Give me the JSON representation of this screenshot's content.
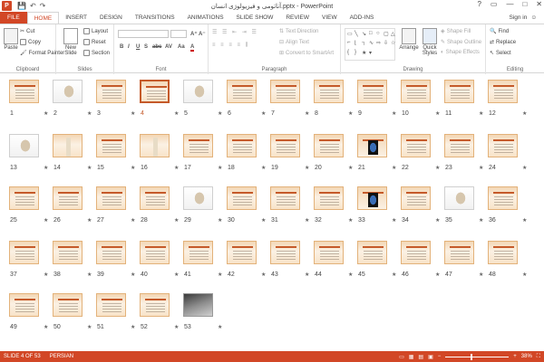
{
  "title": "آناتومی و فیزیولوژی انسان.pptx - PowerPoint",
  "qat": {
    "save_icon": "💾",
    "undo_icon": "↶",
    "redo_icon": "↷"
  },
  "window": {
    "help": "?",
    "restore": "▭",
    "minimize": "—",
    "maximize": "□",
    "close": "✕"
  },
  "tabs": [
    "FILE",
    "HOME",
    "INSERT",
    "DESIGN",
    "TRANSITIONS",
    "ANIMATIONS",
    "SLIDE SHOW",
    "REVIEW",
    "VIEW",
    "ADD-INS"
  ],
  "active_tab": "HOME",
  "signin": "Sign in",
  "ribbon": {
    "clipboard": {
      "paste": "Paste",
      "cut": "Cut",
      "copy": "Copy",
      "format_painter": "Format Painter",
      "label": "Clipboard"
    },
    "slides": {
      "new_slide": "New Slide",
      "layout": "Layout",
      "reset": "Reset",
      "section": "Section",
      "label": "Slides"
    },
    "font": {
      "label": "Font",
      "bold": "B",
      "italic": "I",
      "underline": "U",
      "strike": "S",
      "shadow": "abc",
      "spacing": "AV",
      "case": "Aa",
      "color": "A"
    },
    "paragraph": {
      "text_direction": "Text Direction",
      "align_text": "Align Text",
      "convert_smartart": "Convert to SmartArt",
      "label": "Paragraph"
    },
    "drawing": {
      "arrange": "Arrange",
      "quick_styles": "Quick Styles",
      "shape_fill": "Shape Fill",
      "shape_outline": "Shape Outline",
      "shape_effects": "Shape Effects",
      "label": "Drawing"
    },
    "editing": {
      "find": "Find",
      "replace": "Replace",
      "select": "Select",
      "label": "Editing"
    }
  },
  "slides": [
    "1",
    "2",
    "3",
    "4",
    "5",
    "6",
    "7",
    "8",
    "9",
    "10",
    "11",
    "12",
    "13",
    "14",
    "15",
    "16",
    "17",
    "18",
    "19",
    "20",
    "21",
    "22",
    "23",
    "24",
    "25",
    "26",
    "27",
    "28",
    "29",
    "30",
    "31",
    "32",
    "33",
    "34",
    "35",
    "36",
    "37",
    "38",
    "39",
    "40",
    "41",
    "42",
    "43",
    "44",
    "45",
    "46",
    "47",
    "48",
    "49",
    "50",
    "51",
    "52",
    "53"
  ],
  "selected_slide": "4",
  "status": {
    "slide_info": "SLIDE 4 OF 53",
    "language": "PERSIAN",
    "zoom": "38%",
    "zoom_minus": "−",
    "zoom_plus": "+"
  }
}
